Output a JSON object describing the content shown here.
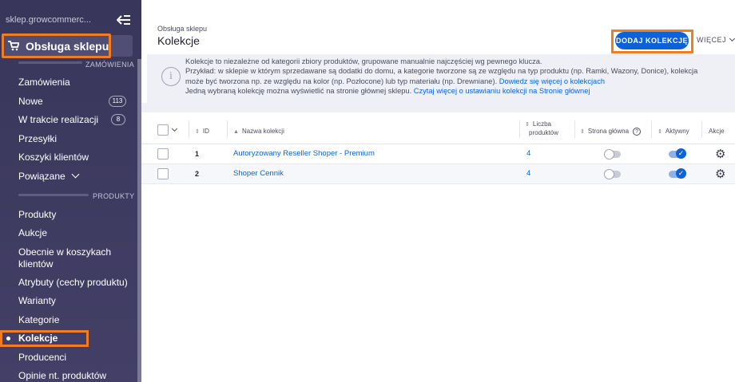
{
  "sidebar": {
    "domain": "sklep.growcommerc...",
    "shop_label": "Obsługa sklepu",
    "sections": {
      "orders": "ZAMÓWIENIA",
      "products": "PRODUKTY"
    },
    "items": [
      {
        "label": "Zamówienia"
      },
      {
        "label": "Nowe",
        "badge": "113"
      },
      {
        "label": "W trakcie realizacji",
        "badge": "8"
      },
      {
        "label": "Przesyłki"
      },
      {
        "label": "Koszyki klientów"
      },
      {
        "label": "Powiązane"
      },
      {
        "label": "Produkty"
      },
      {
        "label": "Aukcje"
      },
      {
        "label": "Obecnie w koszykach",
        "label2": "klientów"
      },
      {
        "label": "Atrybuty (cechy produktu)"
      },
      {
        "label": "Warianty"
      },
      {
        "label": "Kategorie"
      },
      {
        "label": "Kolekcje",
        "active": true
      },
      {
        "label": "Producenci"
      },
      {
        "label": "Opinie nt. produktów"
      }
    ]
  },
  "header": {
    "breadcrumb": "Obsługa sklepu",
    "title": "Kolekcje",
    "add_button": "DODAJ KOLEKCJĘ",
    "more_button": "WIĘCEJ"
  },
  "info": {
    "line1": "Kolekcje to niezależne od kategorii zbiory produktów, grupowane manualnie najczęściej wg pewnego klucza.",
    "line2": "Przykład: w sklepie w którym sprzedawane są dodatki do domu, a kategorie tworzone są ze względu na typ produktu (np. Ramki, Wazony, Donice), kolekcja",
    "line3": "może być tworzona np. ze względu na kolor (np. Pozłocone) lub typ materiału (np. Drewniane).",
    "link1": "Dowiedz się więcej o kolekcjach",
    "line4": "Jedną wybraną kolekcję można wyświetlić na stronie głównej sklepu.",
    "link2": "Czytaj więcej o ustawianiu kolekcji na Stronie głównej"
  },
  "table": {
    "columns": {
      "id": "ID",
      "name": "Nazwa kolekcji",
      "count_line1": "Liczba",
      "count_line2": "produktów",
      "homepage": "Strona główna",
      "active": "Aktywny",
      "actions": "Akcje"
    },
    "rows": [
      {
        "id": "1",
        "name": "Autoryzowany Reseller Shoper - Premium",
        "count": "4",
        "homepage": false,
        "active": true
      },
      {
        "id": "2",
        "name": "Shoper Cennik",
        "count": "4",
        "homepage": false,
        "active": true
      }
    ]
  },
  "colors": {
    "accent": "#0d63d6",
    "highlight": "#f07d22",
    "sidebar": "#3d3a60"
  }
}
